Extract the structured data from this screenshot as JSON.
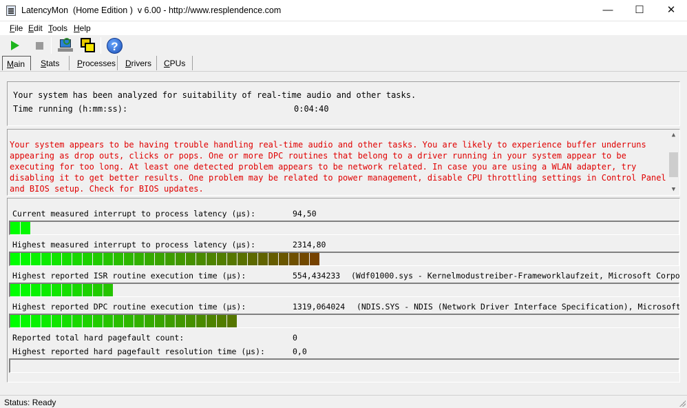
{
  "window": {
    "title": "LatencyMon  (Home Edition )  v 6.00 - http://www.resplendence.com",
    "minimize_glyph": "—",
    "maximize_glyph": "☐",
    "close_glyph": "✕"
  },
  "menu": [
    {
      "acc": "F",
      "rest": "ile"
    },
    {
      "acc": "E",
      "rest": "dit"
    },
    {
      "acc": "T",
      "rest": "ools"
    },
    {
      "acc": "H",
      "rest": "elp"
    }
  ],
  "toolbar": {
    "icons": [
      "start-icon",
      "stop-icon",
      "computer-search-icon",
      "windows-icon",
      "help-icon"
    ],
    "help_glyph": "?"
  },
  "tabs": [
    {
      "acc": "M",
      "rest": "ain",
      "active": true
    },
    {
      "acc": "S",
      "rest": "tats",
      "active": false
    },
    {
      "acc": "P",
      "rest": "rocesses",
      "active": false
    },
    {
      "acc": "D",
      "rest": "rivers",
      "active": false
    },
    {
      "acc": "C",
      "rest": "PUs",
      "active": false
    }
  ],
  "summary": {
    "line1": "Your system has been analyzed for suitability of real-time audio and other tasks.",
    "time_label": "Time running (h:mm:ss):",
    "time_value": "0:04:40"
  },
  "warning": {
    "text": "Your system appears to be having trouble handling real-time audio and other tasks. You are likely to experience buffer underruns appearing as drop outs, clicks or pops. One or more DPC routines that belong to a driver running in your system appear to be executing for too long. At least one detected problem appears to be network related. In case you are using a WLAN adapter, try disabling it to get better results. One problem may be related to power management, disable CPU throttling settings in Control Panel and BIOS setup. Check for BIOS updates.",
    "color": "#e00000"
  },
  "metrics": {
    "interrupt_current": {
      "label": "Current measured interrupt to process latency (µs):",
      "value": "94,50",
      "detail": "",
      "fill_segments": 2
    },
    "interrupt_highest": {
      "label": "Highest measured interrupt to process latency (µs):",
      "value": "2314,80",
      "detail": "",
      "fill_segments": 30
    },
    "isr_highest": {
      "label": "Highest reported ISR routine execution time (µs):",
      "value": "554,434233",
      "detail": "(Wdf01000.sys - Kernelmodustreiber-Frameworklaufzeit, Microsoft Corpo",
      "fill_segments": 10
    },
    "dpc_highest": {
      "label": "Highest reported DPC routine execution time (µs):",
      "value": "1319,064024",
      "detail": "(NDIS.SYS - NDIS (Network Driver Interface Specification), Microsoft",
      "fill_segments": 22
    },
    "pagefault_count": {
      "label": "Reported total hard pagefault count:",
      "value": "0"
    },
    "pagefault_resolution": {
      "label": "Highest reported hard pagefault resolution time (µs):",
      "value": "0,0",
      "fill_segments": 0
    }
  },
  "meter_colors": {
    "start": "#00ff00",
    "end": "#7a3b00"
  },
  "status": {
    "text": "Status: Ready"
  }
}
